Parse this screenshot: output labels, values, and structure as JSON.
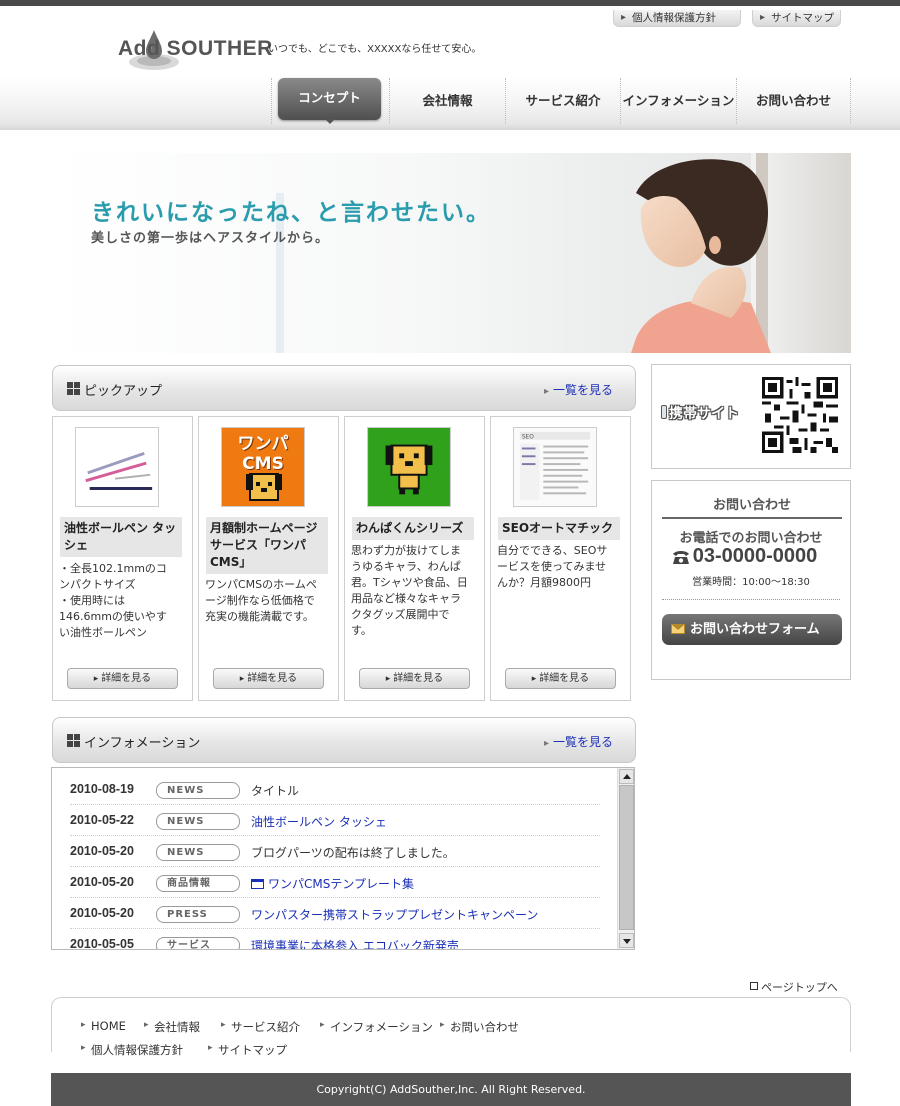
{
  "header": {
    "utility_links": [
      "個人情報保護方針",
      "サイトマップ"
    ],
    "logo_text": "Add SOUTHER",
    "tagline": "いつでも、どこでも、XXXXXなら任せて安心。",
    "nav": [
      "コンセプト",
      "会社情報",
      "サービス紹介",
      "インフォメーション",
      "お問い合わせ"
    ]
  },
  "hero": {
    "headline": "きれいになったね、と言わせたい。",
    "sub": "美しさの第一歩はヘアスタイルから。"
  },
  "pickup": {
    "title": "ピックアップ",
    "more": "一覧を見る",
    "items": [
      {
        "title": "油性ボールペン タッシェ",
        "desc": "・全長102.1mmのコンパクトサイズ\n・使用時には146.6mmの使いやすい油性ボールペン",
        "button": "詳細を見る"
      },
      {
        "title": "月額制ホームページサービス「ワンパCMS」",
        "desc": "ワンパCMSのホームページ制作なら低価格で充実の機能満載です。",
        "button": "詳細を見る",
        "thumb_text": "ワンパCMS"
      },
      {
        "title": "わんぱくんシリーズ",
        "desc": "思わず力が抜けてしまうゆるキャラ、わんぱ君。Tシャツや食品、日用品など様々なキャラクタグッズ展開中です。",
        "button": "詳細を見る"
      },
      {
        "title": "SEOオートマチック",
        "desc": "自分でできる、SEOサービスを使ってみませんか？月額9800円",
        "button": "詳細を見る"
      }
    ]
  },
  "information": {
    "title": "インフォメーション",
    "more": "一覧を見る",
    "rows": [
      {
        "date": "2010-08-19",
        "badge": "NEWS",
        "text": "タイトル",
        "link": false
      },
      {
        "date": "2010-05-22",
        "badge": "NEWS",
        "text": "油性ボールペン タッシェ",
        "link": true
      },
      {
        "date": "2010-05-20",
        "badge": "NEWS",
        "text": "ブログパーツの配布は終了しました。",
        "link": false
      },
      {
        "date": "2010-05-20",
        "badge": "商品情報",
        "text": "ワンパCMSテンプレート集",
        "link": true,
        "window_icon": true
      },
      {
        "date": "2010-05-20",
        "badge": "PRESS",
        "text": "ワンパスター携帯ストラッププレゼントキャンペーン",
        "link": true
      },
      {
        "date": "2010-05-05",
        "badge": "サービス",
        "text": "環境事業に本格参入 エコバック新発売",
        "link": true
      }
    ]
  },
  "sidebar": {
    "mobile_label": "携帯サイト",
    "contact": {
      "title": "お問い合わせ",
      "phone_label": "お電話でのお問い合わせ",
      "phone": "03-0000-0000",
      "hours": "営業時間：10:00〜18:30",
      "form_button": "お問い合わせフォーム"
    }
  },
  "footer": {
    "pagetop": "ページトップへ",
    "links": [
      "HOME",
      "会社情報",
      "サービス紹介",
      "インフォメーション",
      "お問い合わせ",
      "個人情報保護方針",
      "サイトマップ"
    ],
    "copyright": "Copyright(C) AddSouther,Inc. All Right Reserved."
  },
  "colors": {
    "accent": "#2a9cae",
    "link": "#1a2fb8",
    "dark": "#555555"
  }
}
